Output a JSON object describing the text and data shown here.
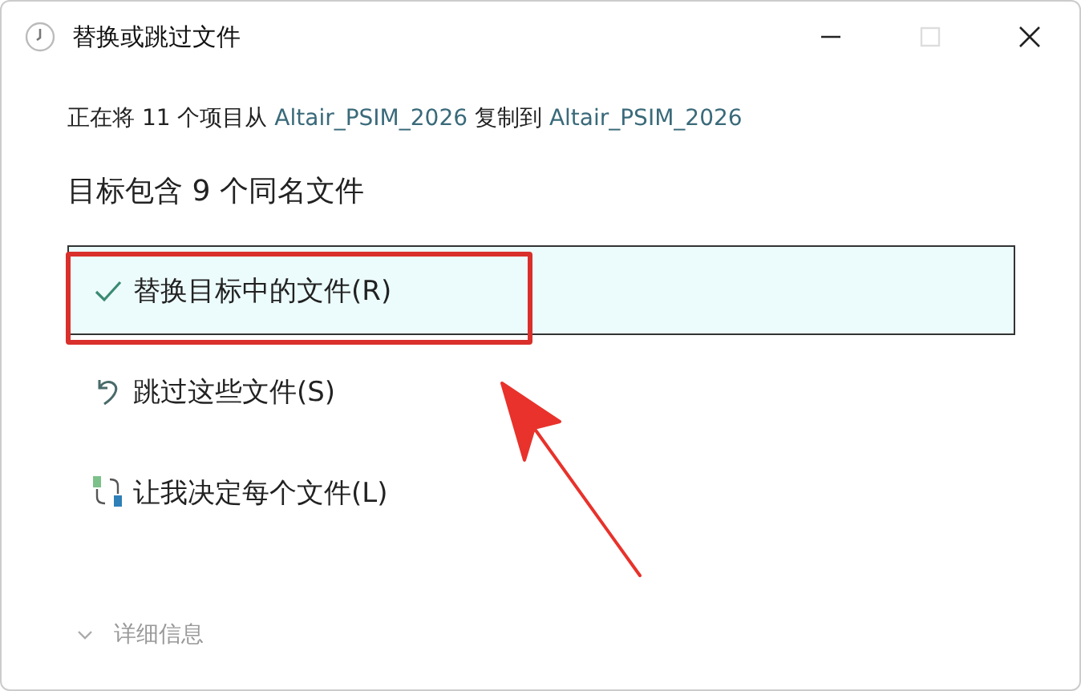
{
  "window": {
    "title": "替换或跳过文件",
    "controls": [
      {
        "kind": "minimize",
        "disabled": false
      },
      {
        "kind": "maximize",
        "disabled": true
      },
      {
        "kind": "close",
        "disabled": false
      }
    ]
  },
  "message": [
    {
      "kind": "text",
      "text": "正在将 11 个项目从 "
    },
    {
      "kind": "link",
      "text": "Altair_PSIM_2026"
    },
    {
      "kind": "text",
      "text": " 复制到 "
    },
    {
      "kind": "link",
      "text": "Altair_PSIM_2026"
    }
  ],
  "heading": "目标包含 9 个同名文件",
  "options": [
    {
      "kind": "replace",
      "label": "替换目标中的文件(R)",
      "selected": true
    },
    {
      "kind": "skip",
      "label": "跳过这些文件(S)",
      "selected": false
    },
    {
      "kind": "decide",
      "label": "让我决定每个文件(L)",
      "selected": false
    }
  ],
  "details": {
    "label": "详细信息",
    "expanded": false
  }
}
